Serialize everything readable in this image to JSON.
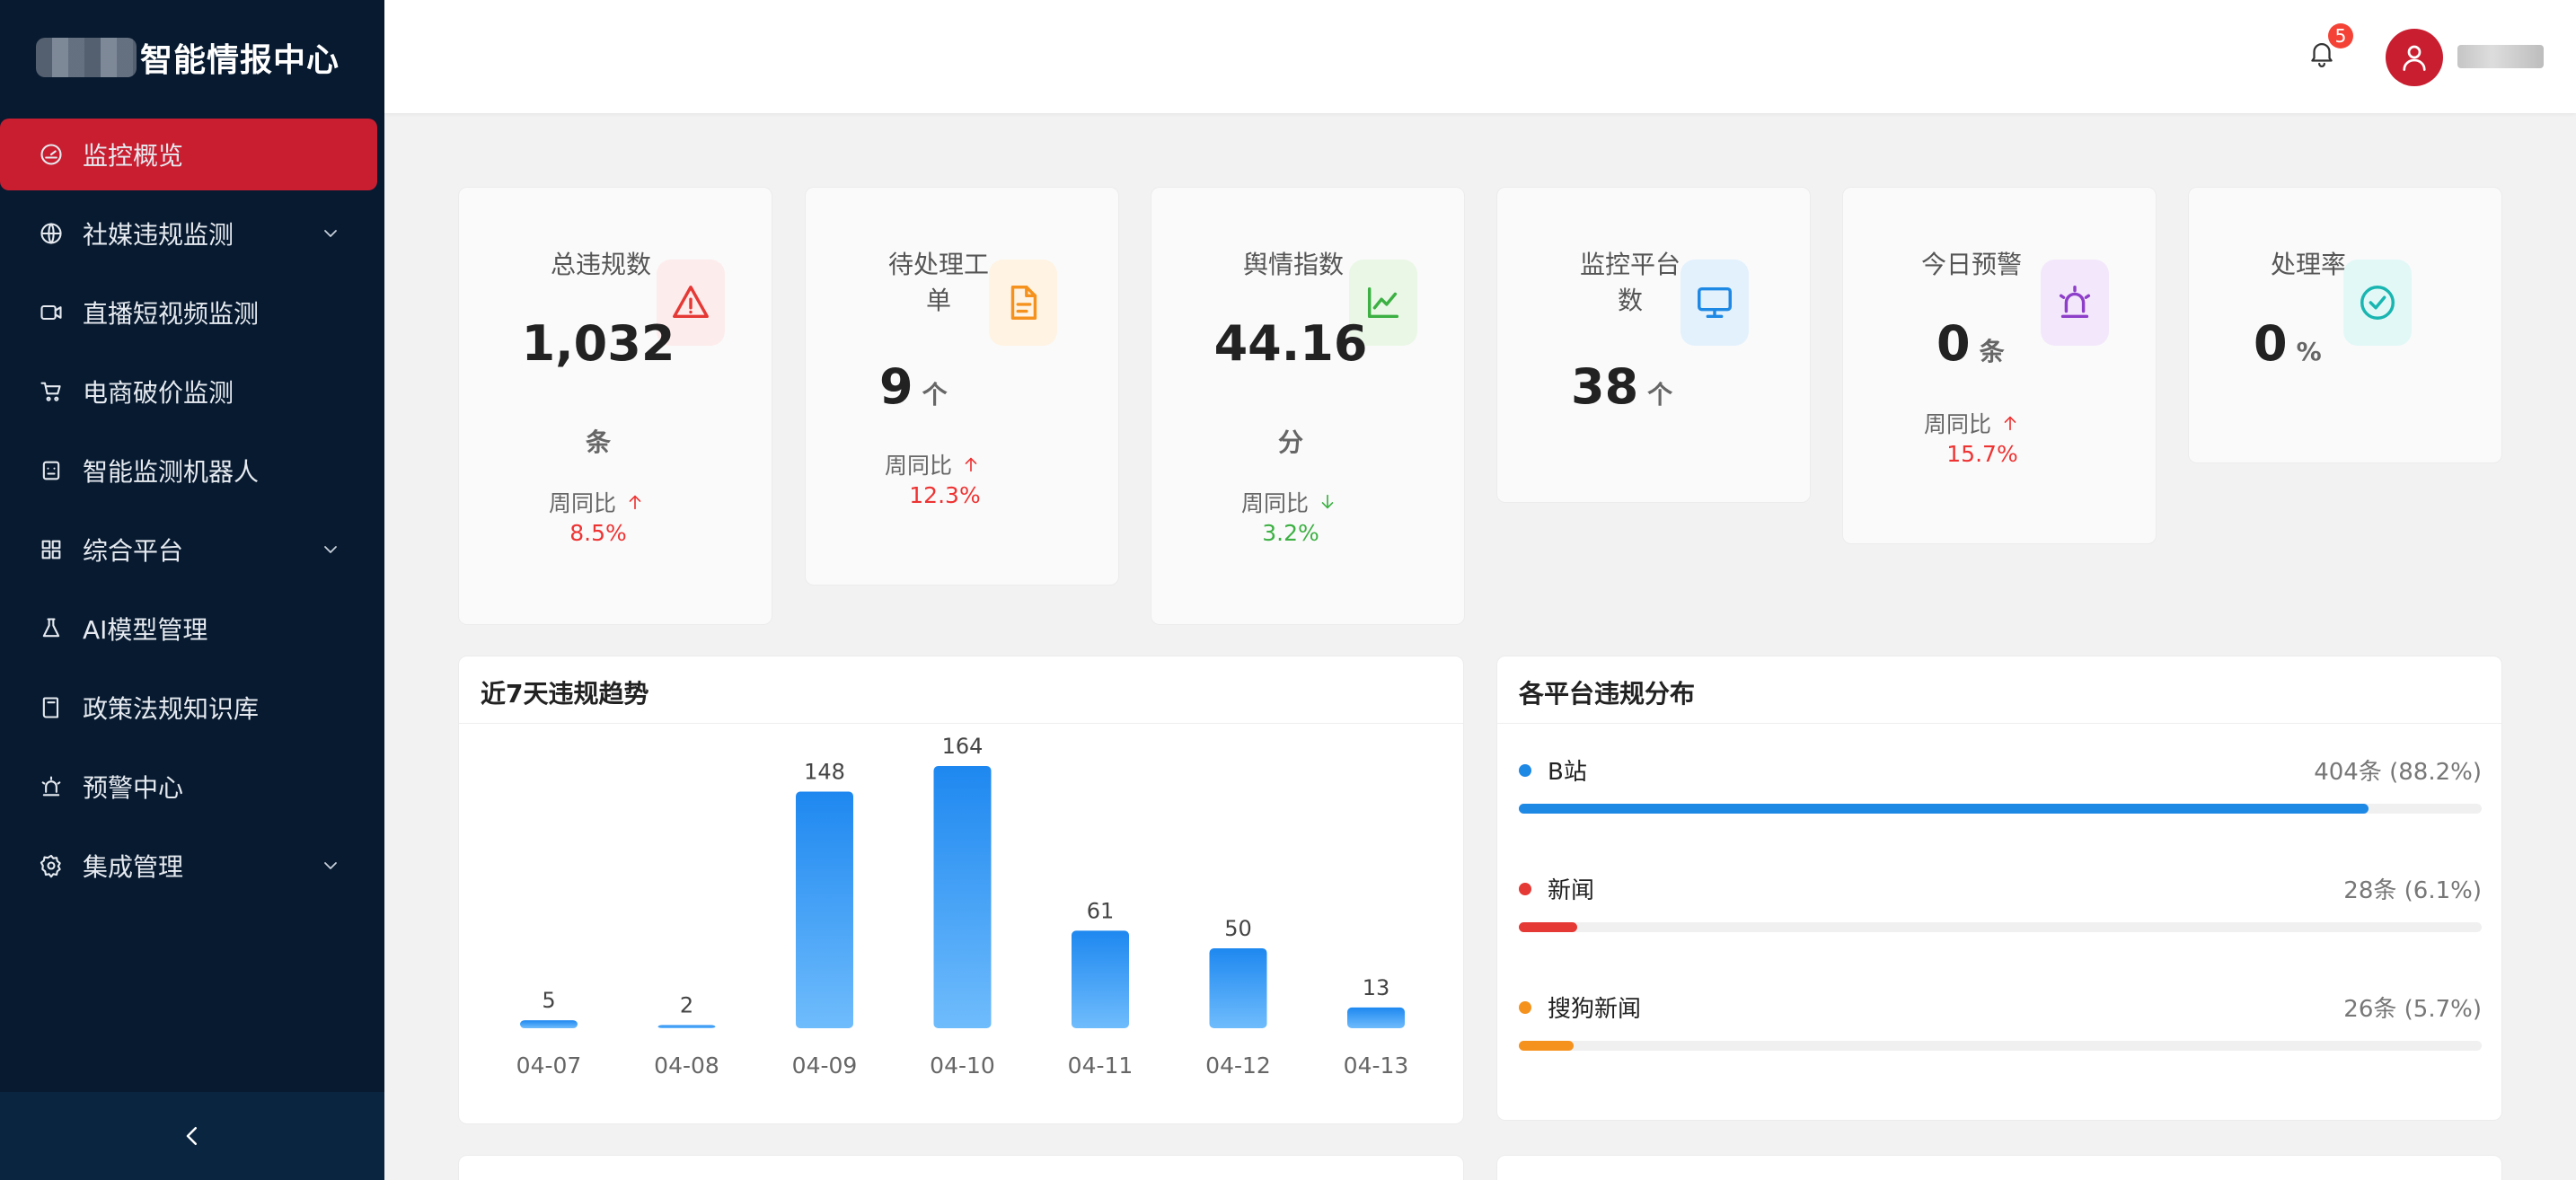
{
  "app": {
    "title": "智能情报中心",
    "collapse_icon": "chevron-left-icon"
  },
  "sidebar": {
    "items": [
      {
        "label": "监控概览",
        "icon": "dashboard-icon",
        "active": true,
        "has_children": false
      },
      {
        "label": "社媒违规监测",
        "icon": "globe-icon",
        "active": false,
        "has_children": true
      },
      {
        "label": "直播短视频监测",
        "icon": "video-icon",
        "active": false,
        "has_children": false
      },
      {
        "label": "电商破价监测",
        "icon": "cart-icon",
        "active": false,
        "has_children": false
      },
      {
        "label": "智能监测机器人",
        "icon": "robot-icon",
        "active": false,
        "has_children": false
      },
      {
        "label": "综合平台",
        "icon": "grid-icon",
        "active": false,
        "has_children": true
      },
      {
        "label": "AI模型管理",
        "icon": "flask-icon",
        "active": false,
        "has_children": false
      },
      {
        "label": "政策法规知识库",
        "icon": "book-icon",
        "active": false,
        "has_children": false
      },
      {
        "label": "预警中心",
        "icon": "siren-icon",
        "active": false,
        "has_children": false
      },
      {
        "label": "集成管理",
        "icon": "gear-icon",
        "active": false,
        "has_children": true
      }
    ]
  },
  "header": {
    "notification_count": "5",
    "bell_icon": "bell-icon",
    "avatar_icon": "user-icon"
  },
  "stats": [
    {
      "label": "总违规数",
      "value": "1,032",
      "unit": "条",
      "compare_label": "周同比",
      "change": "8.5%",
      "trend": "up",
      "icon": "warning-icon",
      "icon_color": "#e53935",
      "icon_bg": "#fdecec"
    },
    {
      "label": "待处理工单",
      "value": "9",
      "unit": "个",
      "compare_label": "周同比",
      "change": "12.3%",
      "trend": "up",
      "icon": "document-icon",
      "icon_color": "#f5921e",
      "icon_bg": "#fff3e3"
    },
    {
      "label": "舆情指数",
      "value": "44.16",
      "unit": "分",
      "compare_label": "周同比",
      "change": "3.2%",
      "trend": "down",
      "icon": "line-chart-icon",
      "icon_color": "#3cb043",
      "icon_bg": "#eaf7e6"
    },
    {
      "label": "监控平台数",
      "value": "38",
      "unit": "个",
      "icon": "monitor-icon",
      "icon_color": "#1e88e5",
      "icon_bg": "#e3f1fd"
    },
    {
      "label": "今日预警",
      "value": "0",
      "unit": "条",
      "compare_label": "周同比",
      "change": "15.7%",
      "trend": "up",
      "icon": "siren-icon",
      "icon_color": "#8e3fc9",
      "icon_bg": "#f3e8fb"
    },
    {
      "label": "处理率",
      "value": "0",
      "unit": "%",
      "icon": "check-circle-icon",
      "icon_color": "#19b5b0",
      "icon_bg": "#e2f8f7"
    }
  ],
  "trend_panel": {
    "title": "近7天违规趋势",
    "chart_data": {
      "type": "bar",
      "categories": [
        "04-07",
        "04-08",
        "04-09",
        "04-10",
        "04-11",
        "04-12",
        "04-13"
      ],
      "values": [
        5,
        2,
        148,
        164,
        61,
        50,
        13
      ],
      "xlabel": "",
      "ylabel": "",
      "bar_color_top": "#1e88f0",
      "bar_color_bottom": "#6fbcfc",
      "grid": false,
      "legend": "none"
    }
  },
  "distribution_panel": {
    "title": "各平台违规分布",
    "items": [
      {
        "name": "B站",
        "value": "404条 (88.2%)",
        "percent": 88.2,
        "color": "#1e88e5"
      },
      {
        "name": "新闻",
        "value": "28条 (6.1%)",
        "percent": 6.1,
        "color": "#e53935"
      },
      {
        "name": "搜狗新闻",
        "value": "26条 (5.7%)",
        "percent": 5.7,
        "color": "#f5921e"
      }
    ]
  }
}
